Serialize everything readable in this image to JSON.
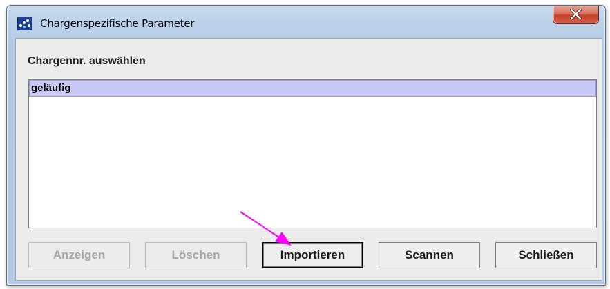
{
  "window": {
    "title": "Chargenspezifische Parameter",
    "icon": "app-dots-icon",
    "close_icon": "close-x-icon"
  },
  "section": {
    "label": "Chargennr. auswählen"
  },
  "list": {
    "items": [
      {
        "label": "geläufig",
        "selected": true
      }
    ]
  },
  "buttons": {
    "show": {
      "label": "Anzeigen",
      "enabled": false
    },
    "delete": {
      "label": "Löschen",
      "enabled": false
    },
    "import": {
      "label": "Importieren",
      "enabled": true
    },
    "scan": {
      "label": "Scannen",
      "enabled": true
    },
    "close": {
      "label": "Schließen",
      "enabled": true
    }
  },
  "annotation": {
    "arrow_color": "#ff00ff",
    "target": "import-button"
  },
  "colors": {
    "selection": "#c8c8f4",
    "close_button": "#c8412a",
    "titlebar": "#c9dbee"
  }
}
